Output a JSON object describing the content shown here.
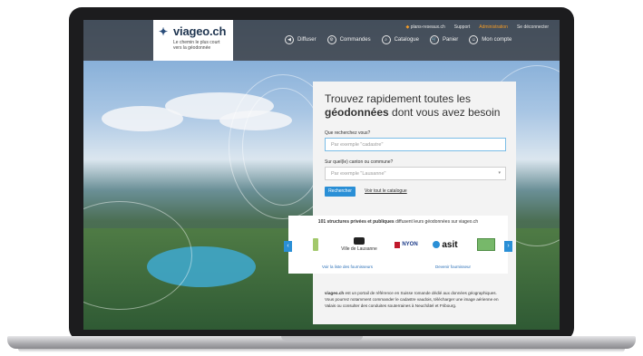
{
  "brand": {
    "logo_text_light": "via",
    "logo_text_bold": "geo.ch",
    "tagline": "Le chemin le plus court vers la géodonnée"
  },
  "top_links": {
    "plans": "plans-reseaux.ch",
    "support": "Support",
    "admin": "Administration",
    "logout": "Se déconnecter"
  },
  "nav": {
    "items": [
      {
        "label": "Diffuser",
        "icon": "arrow-left-circle-icon",
        "glyph": "◀"
      },
      {
        "label": "Commandes",
        "icon": "gear-circle-icon",
        "glyph": "⚙"
      },
      {
        "label": "Catalogue",
        "icon": "search-circle-icon",
        "glyph": "⌕"
      },
      {
        "label": "Panier",
        "icon": "cart-circle-icon",
        "glyph": "🛒"
      },
      {
        "label": "Mon compte",
        "icon": "user-circle-icon",
        "glyph": "☺"
      }
    ]
  },
  "hero": {
    "title_part1": "Trouvez rapidement toutes les",
    "title_bold": "géodonnées",
    "title_part2": "dont vous avez besoin"
  },
  "search": {
    "label_what": "Que recherchez vous?",
    "placeholder_what": "Par exemple \"cadastre\"",
    "label_where": "Sur quel(le) canton ou commune?",
    "placeholder_where": "Par exemple \"Lausanne\"",
    "button": "Rechercher",
    "catalog_link": "Voir tout le catalogue"
  },
  "partners": {
    "count_bold": "101 structures privées et publiques",
    "count_rest": "diffusent leurs géodonnées sur viageo.ch",
    "lausanne": "Ville de Lausanne",
    "nyon": "NYON",
    "asit": "asit",
    "list_link": "Voir la liste des fournisseurs",
    "become_link": "Devenir fournisseur"
  },
  "about": {
    "brand": "viageo.ch",
    "text": "est un portail de référence en Suisse romande dédié aux données géographiques. Vous pourrez notamment commander le cadastre vaudois, télécharger une image aérienne en Valais ou consulter des conduites souterraines à Neuchâtel et Fribourg."
  },
  "colors": {
    "accent": "#2a8fd6",
    "admin": "#f29a26",
    "header_bg": "#37373a"
  }
}
